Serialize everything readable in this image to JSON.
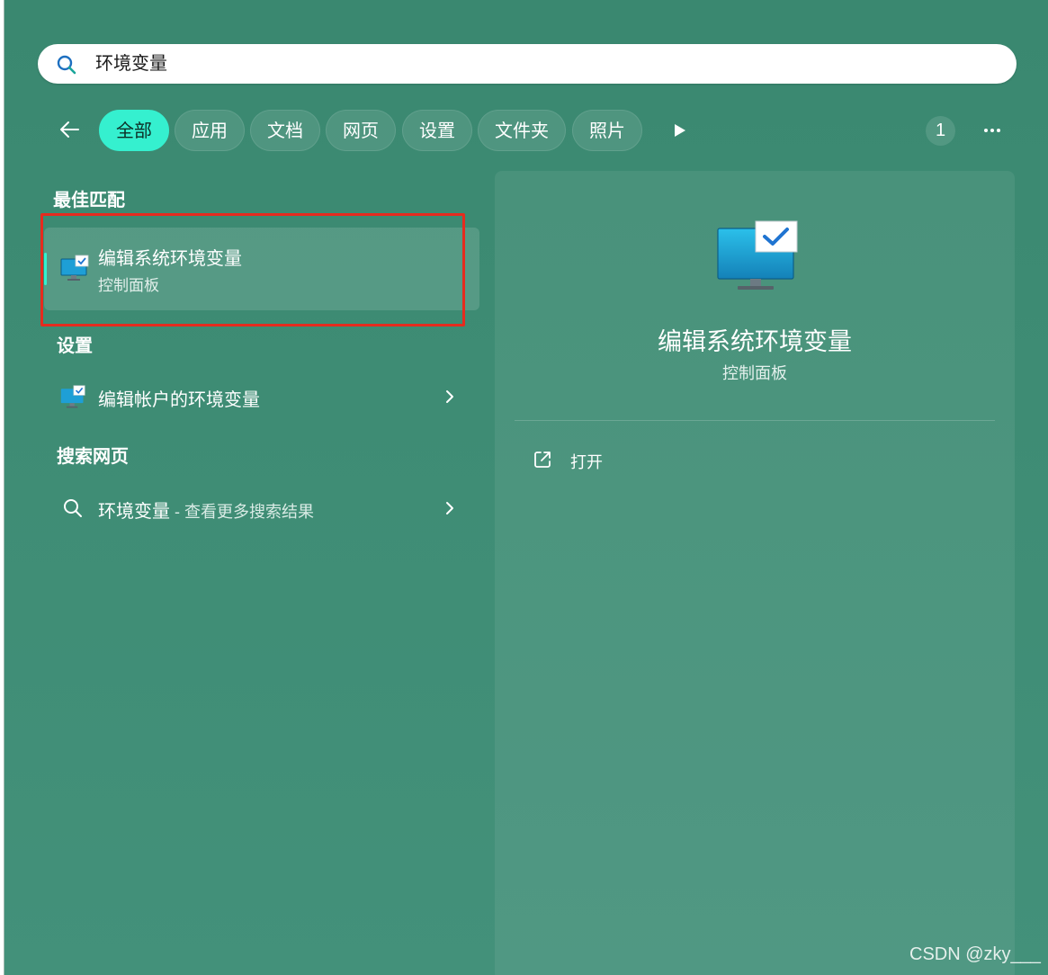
{
  "search": {
    "query": "环境变量",
    "icon": "search-icon"
  },
  "filters": {
    "back_icon": "back-arrow-icon",
    "chips": [
      "全部",
      "应用",
      "文档",
      "网页",
      "设置",
      "文件夹",
      "照片"
    ],
    "active_index": 0,
    "play_icon": "play-icon",
    "count": "1",
    "more_icon": "more-icon"
  },
  "sections": {
    "best_match": "最佳匹配",
    "settings": "设置",
    "web_search": "搜索网页"
  },
  "best_match_item": {
    "title": "编辑系统环境变量",
    "subtitle": "控制面板",
    "icon": "monitor-settings-icon"
  },
  "settings_item": {
    "title": "编辑帐户的环境变量",
    "icon": "monitor-settings-icon"
  },
  "web_item": {
    "title": "环境变量",
    "suffix": " - 查看更多搜索结果",
    "icon": "search-icon"
  },
  "detail": {
    "title": "编辑系统环境变量",
    "subtitle": "控制面板",
    "action_label": "打开",
    "action_icon": "open-external-icon"
  },
  "colors": {
    "background": "#3e8c74",
    "accent": "#35f0cf",
    "highlight_frame": "#e62b1e"
  },
  "watermark": "CSDN @zky___"
}
